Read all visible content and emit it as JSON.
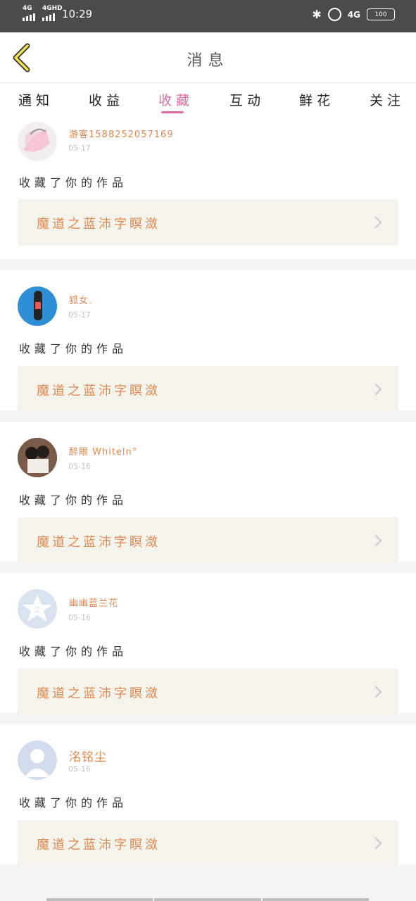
{
  "status_bar": {
    "sim1": "4G",
    "sim2": "4GHD",
    "time": "10:29",
    "net": "4G",
    "battery": "100"
  },
  "header": {
    "title": "消息"
  },
  "tabs": [
    {
      "label": "通知"
    },
    {
      "label": "收益"
    },
    {
      "label": "收藏",
      "active": true
    },
    {
      "label": "互动"
    },
    {
      "label": "鲜花"
    },
    {
      "label": "关注"
    }
  ],
  "messages": [
    {
      "user": "游客1588252057169",
      "date": "05-17",
      "action": "收藏了你的作品",
      "work": "魔道之蓝沛字瞑潋"
    },
    {
      "user": "狐女.",
      "date": "05-17",
      "action": "收藏了你的作品",
      "work": "魔道之蓝沛字瞑潋"
    },
    {
      "user": "醉眼 Whiteln°",
      "date": "05-16",
      "action": "收藏了你的作品",
      "work": "魔道之蓝沛字瞑潋"
    },
    {
      "user": "幽幽蓝兰花",
      "date": "05-16",
      "action": "收藏了你的作品",
      "work": "魔道之蓝沛字瞑潋"
    },
    {
      "user": "洺铭尘",
      "date": "05-16",
      "action": "收藏了你的作品",
      "work": "魔道之蓝沛字瞑潋"
    }
  ],
  "colors": {
    "accent": "#e26aa2",
    "name": "#e0894f",
    "work_bg": "#f4f3ec"
  }
}
